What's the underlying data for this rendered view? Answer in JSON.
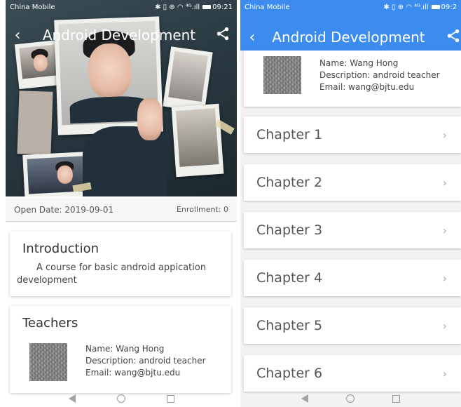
{
  "left": {
    "status": {
      "carrier": "China Mobile",
      "icons": "✱ ▯ ⊕ ◠ ⁴ᴳ.ıll",
      "time": "09:21"
    },
    "header": {
      "title": "Android Development",
      "back_icon": "chevron-left-icon",
      "share_icon": "share-icon"
    },
    "meta": {
      "open_date": "Open Date: 2019-09-01",
      "enrollment": "Enrollment: 0"
    },
    "introduction": {
      "title": "Introduction",
      "body": "A course for basic android appication development"
    },
    "teachers": {
      "title": "Teachers",
      "items": [
        {
          "name": "Name: Wang Hong",
          "description": "Description: android teacher",
          "email": "Email: wang@bjtu.edu"
        }
      ]
    }
  },
  "right": {
    "status": {
      "carrier": "China Mobile",
      "icons": "✱ ▯ ⊕ ◠ ⁴ᴳ.ıll",
      "time": "09:2"
    },
    "header": {
      "title": "Android Development",
      "back_icon": "chevron-left-icon",
      "share_icon": "share-icon",
      "accent": "#3c8cf0"
    },
    "teacher": {
      "name": "Name: Wang Hong",
      "description": "Description: android teacher",
      "email": "Email: wang@bjtu.edu"
    },
    "chapters": [
      {
        "label": "Chapter 1"
      },
      {
        "label": "Chapter 2"
      },
      {
        "label": "Chapter 3"
      },
      {
        "label": "Chapter 4"
      },
      {
        "label": "Chapter 5"
      },
      {
        "label": "Chapter 6"
      }
    ],
    "chevron": "›"
  }
}
